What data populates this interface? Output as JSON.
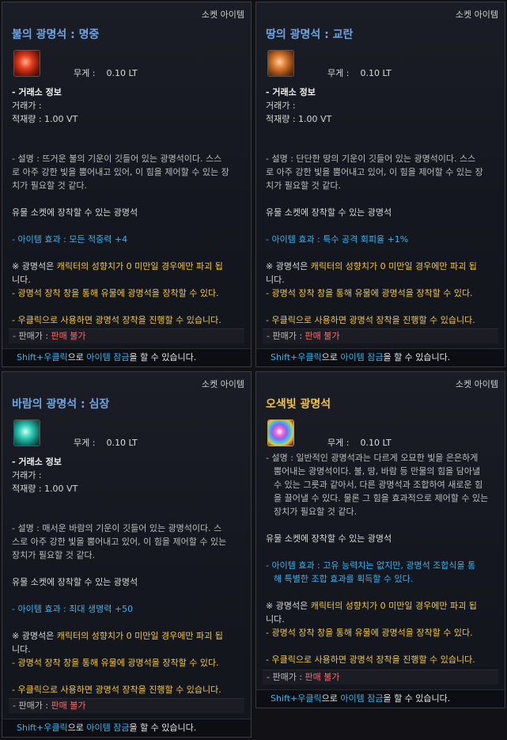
{
  "cards": [
    {
      "category": "소켓 아이템",
      "title": "불의 광명석 : 명중",
      "icon": "fire-gem-icon",
      "weight_label": "무게 :",
      "weight_value": "0.10 LT",
      "market_header": "- 거래소 정보",
      "price_label": "거래가 :",
      "stock_label": "적재량 : 1.00 VT",
      "desc_1": "- 설명 : 뜨거운 불의 기운이 깃들어 있는 광명석이다. 스스",
      "desc_2": "로 아주 강한 빛을 뿜어내고 있어, 이 힘을 제어할 수 있는 장",
      "desc_3": "치가 필요할 것 같다.",
      "socket_text": "유물 소켓에 장착할 수 있는 광명석",
      "effect": "- 아이템 효과 : 모든 적중력 +4",
      "warn_prefix": "※ 광명석은 ",
      "warn_gold": "캐릭터의 성향치가 0 미만일 경우에만 파괴 됩",
      "warn_end": "니다.",
      "equip_text": "- 광명석 장착 창을 통해 유물에 광명석을 장착할 수 있다.",
      "rightclick_text": "- 우클릭으로 사용하면 광명석 장착을 진행할 수 있습니다.",
      "sell_label": "- 판매가 :",
      "sell_value": "판매 불가",
      "foot_shift": "Shift+우클릭",
      "foot_mid": "으로 ",
      "foot_lock": "아이템 잠금",
      "foot_end": "을 할 수 있습니다."
    },
    {
      "category": "소켓 아이템",
      "title": "땅의 광명석 : 교란",
      "icon": "earth-gem-icon",
      "weight_label": "무게 :",
      "weight_value": "0.10 LT",
      "market_header": "- 거래소 정보",
      "price_label": "거래가 :",
      "stock_label": "적재량 : 1.00 VT",
      "desc_1": "- 설명 : 단단한 땅의 기운이 깃들어 있는 광명석이다. 스스",
      "desc_2": "로 아주 강한 빛을 뿜어내고 있어, 이 힘을 제어할 수 있는 장",
      "desc_3": "치가 필요할 것 같다.",
      "socket_text": "유물 소켓에 장착할 수 있는 광명석",
      "effect": "- 아이템 효과 : 특수 공격 회피율 +1%",
      "warn_prefix": "※ 광명석은 ",
      "warn_gold": "캐릭터의 성향치가 0 미만일 경우에만 파괴 됩",
      "warn_end": "니다.",
      "equip_text": "- 광명석 장착 창을 통해 유물에 광명석을 장착할 수 있다.",
      "rightclick_text": "- 우클릭으로 사용하면 광명석 장착을 진행할 수 있습니다.",
      "sell_label": "- 판매가 :",
      "sell_value": "판매 불가",
      "foot_shift": "Shift+우클릭",
      "foot_mid": "으로 ",
      "foot_lock": "아이템 잠금",
      "foot_end": "을 할 수 있습니다."
    },
    {
      "category": "소켓 아이템",
      "title": "바람의 광명석 : 심장",
      "icon": "wind-gem-icon",
      "weight_label": "무게 :",
      "weight_value": "0.10 LT",
      "market_header": "- 거래소 정보",
      "price_label": "거래가 :",
      "stock_label": "적재량 : 1.00 VT",
      "desc_1": "- 설명 : 매서운 바람의 기운이 깃들어 있는 광명석이다. 스",
      "desc_2": "스로 아주 강한 빛을 뿜어내고 있어, 이 힘을 제어할 수 있는",
      "desc_3": "장치가 필요할 것 같다.",
      "socket_text": "유물 소켓에 장착할 수 있는 광명석",
      "effect": "- 아이템 효과 : 최대 생명력 +50",
      "warn_prefix": "※ 광명석은 ",
      "warn_gold": "캐릭터의 성향치가 0 미만일 경우에만 파괴 됩",
      "warn_end": "니다.",
      "equip_text": "- 광명석 장착 창을 통해 유물에 광명석을 장착할 수 있다.",
      "rightclick_text": "- 우클릭으로 사용하면 광명석 장착을 진행할 수 있습니다.",
      "sell_label": "- 판매가 :",
      "sell_value": "판매 불가",
      "foot_shift": "Shift+우클릭",
      "foot_mid": "으로 ",
      "foot_lock": "아이템 잠금",
      "foot_end": "을 할 수 있습니다."
    },
    {
      "category": "소켓 아이템",
      "title": "오색빛 광명석",
      "icon": "rainbow-gem-icon",
      "weight_label": "무게 :",
      "weight_value": "0.10 LT",
      "desc_1": "- 설명 : 일반적인 광명석과는 다르게 오묘한 빛을 은은하게",
      "desc_2": "뿜어내는 광명석이다. 불, 땅, 바람 등 만물의 힘을 담아낼",
      "desc_3": "수 있는 그릇과 같아서, 다른 광명석과 조합하여 새로운 힘",
      "desc_4": "을 끌어낼 수 있다. 물론 그 힘을 효과적으로 제어할 수 있는",
      "desc_5": "장치가 필요할 것 같다.",
      "socket_text": "유물 소켓에 장착할 수 있는 광명석",
      "effect_1": "- 아이템 효과 : 고유 능력치는 없지만, 광명석 조합식을 통",
      "effect_2": "해 특별한 조합 효과를 획득할 수 있다.",
      "warn_prefix": "※ 광명석은 ",
      "warn_gold": "캐릭터의 성향치가 0 미만일 경우에만 파괴 됩",
      "warn_end": "니다.",
      "equip_text": "- 광명석 장착 창을 통해 유물에 광명석을 장착할 수 있다.",
      "rightclick_text": "- 우클릭으로 사용하면 광명석 장착을 진행할 수 있습니다.",
      "sell_label": "- 판매가 :",
      "sell_value": "판매 불가",
      "foot_shift": "Shift+우클릭",
      "foot_mid": "으로 ",
      "foot_lock": "아이템 잠금",
      "foot_end": "을 할 수 있습니다."
    }
  ]
}
